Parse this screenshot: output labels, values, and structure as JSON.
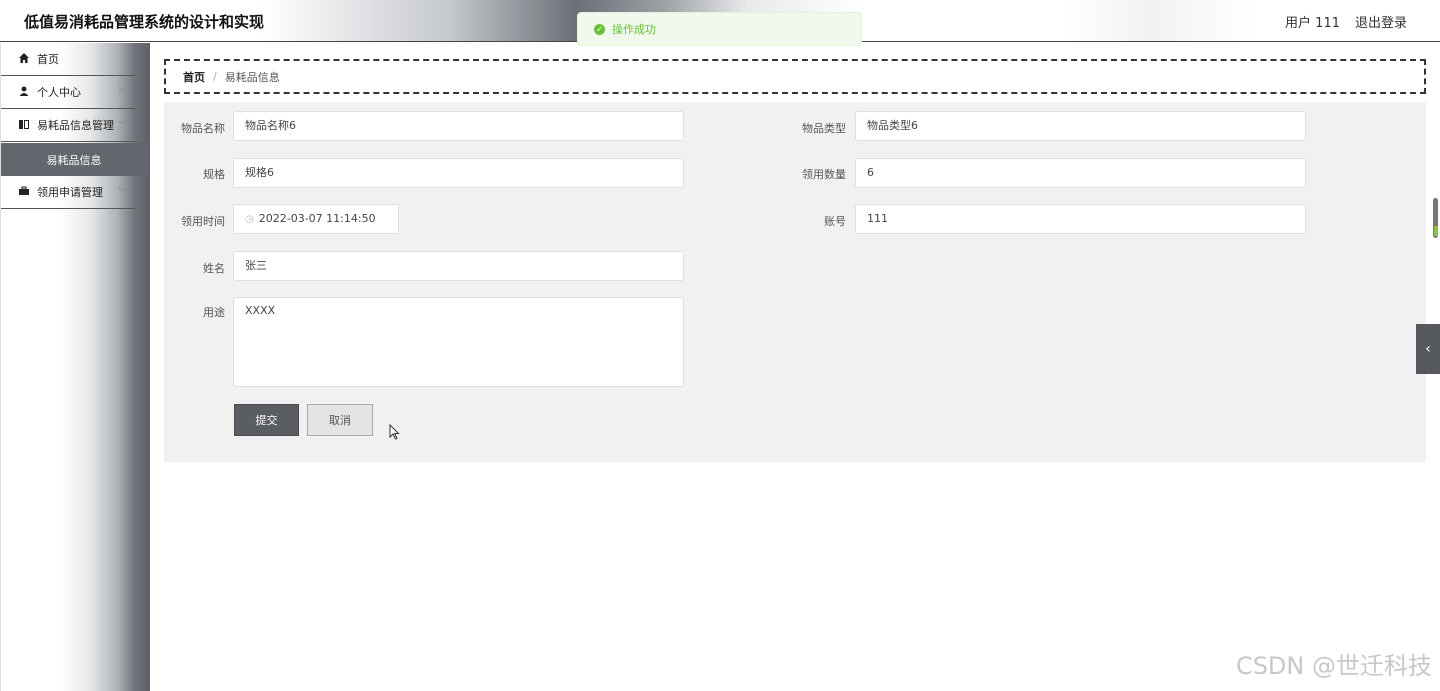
{
  "header": {
    "app_title": "低值易消耗品管理系统的设计和实现",
    "user_label": "用户 111",
    "logout_label": "退出登录"
  },
  "toast": {
    "message": "操作成功",
    "color": "#67c23a"
  },
  "sidebar": {
    "items": [
      {
        "label": "首页",
        "icon": "home-icon"
      },
      {
        "label": "个人中心",
        "icon": "user-icon"
      },
      {
        "label": "易耗品信息管理",
        "icon": "book-icon"
      },
      {
        "label": "领用申请管理",
        "icon": "briefcase-icon"
      }
    ],
    "active_sub_item": "易耗品信息"
  },
  "breadcrumb": {
    "home": "首页",
    "separator": "/",
    "current": "易耗品信息"
  },
  "form": {
    "item_name": {
      "label": "物品名称",
      "value": "物品名称6"
    },
    "item_type": {
      "label": "物品类型",
      "value": "物品类型6"
    },
    "spec": {
      "label": "规格",
      "value": "规格6"
    },
    "quantity": {
      "label": "领用数量",
      "value": "6"
    },
    "use_time": {
      "label": "领用时间",
      "value": "2022-03-07 11:14:50"
    },
    "account": {
      "label": "账号",
      "value": "111"
    },
    "name": {
      "label": "姓名",
      "value": "张三"
    },
    "purpose": {
      "label": "用途",
      "value": "XXXX"
    },
    "submit_label": "提交",
    "cancel_label": "取消"
  },
  "colors": {
    "accent": "#5a5d62",
    "success": "#67c23a"
  },
  "watermark": "CSDN @世迁科技"
}
